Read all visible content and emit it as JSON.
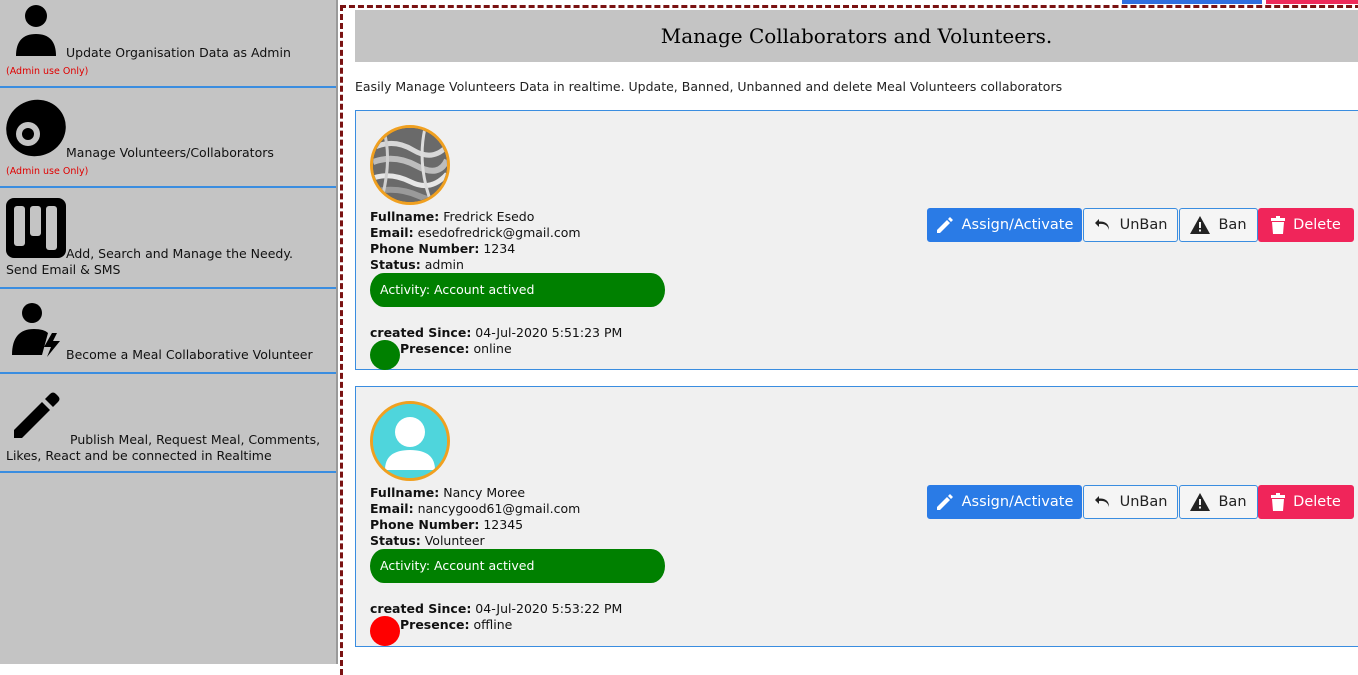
{
  "sidebar": {
    "items": [
      {
        "icon": "user-icon",
        "label": "Update Organisation Data as Admin",
        "note": "(Admin use Only)"
      },
      {
        "icon": "volunteers-icon",
        "label": "Manage Volunteers/Collaborators",
        "note": "(Admin use Only)"
      },
      {
        "icon": "board-icon",
        "label": "Add, Search and Manage the Needy. Send Email & SMS"
      },
      {
        "icon": "user-bolt-icon",
        "label": "Become a Meal Collaborative Volunteer"
      },
      {
        "icon": "pencil-icon",
        "label": "Publish Meal, Request Meal, Comments, Likes, React and be connected in Realtime"
      }
    ]
  },
  "main": {
    "title": "Manage Collaborators and Volunteers.",
    "intro": "Easily Manage Volunteers Data in realtime. Update, Banned, Unbanned and delete Meal Volunteers collaborators"
  },
  "labels": {
    "fullname": "Fullname:",
    "email": "Email:",
    "phone": "Phone Number:",
    "status": "Status:",
    "created": "created Since:",
    "presence": "Presence:"
  },
  "buttons": {
    "assign": "Assign/Activate",
    "unban": "UnBan",
    "ban": "Ban",
    "delete": "Delete"
  },
  "users": [
    {
      "fullname": "Fredrick Esedo",
      "email": "esedofredrick@gmail.com",
      "phone": "1234",
      "status": "admin",
      "activity": "Activity: Account actived",
      "created": "04-Jul-2020 5:51:23 PM",
      "presence": "online",
      "presence_color": "#008000",
      "avatar": "photo-avatar"
    },
    {
      "fullname": "Nancy Moree",
      "email": "nancygood61@gmail.com",
      "phone": "12345",
      "status": "Volunteer",
      "activity": "Activity: Account actived",
      "created": "04-Jul-2020 5:53:22 PM",
      "presence": "offline",
      "presence_color": "#ff0000",
      "avatar": "default-avatar"
    }
  ],
  "colors": {
    "accent": "#2a7be6",
    "danger": "#f0255a",
    "activity": "#008000",
    "border": "#3a8de0"
  }
}
